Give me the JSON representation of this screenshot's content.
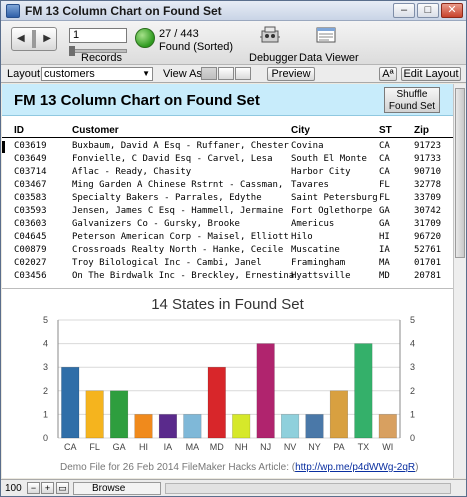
{
  "window": {
    "title": "FM 13 Column Chart on Found Set",
    "minimize_glyph": "–",
    "maximize_glyph": "□",
    "close_glyph": "✕"
  },
  "toolbar": {
    "record_number": "1",
    "records_label": "Records",
    "found_count": "27 / 443",
    "found_status": "Found (Sorted)",
    "debugger_label": "Debugger",
    "data_viewer_label": "Data Viewer",
    "book_icon": "book-navigation-icon",
    "pie_icon": "found-set-pie-icon"
  },
  "layout_bar": {
    "layout_label": "Layout:",
    "layout_value": "customers",
    "view_as_label": "View As:",
    "preview_label": "Preview",
    "font_size_label": "Aª",
    "edit_layout_label": "Edit Layout"
  },
  "header": {
    "title": "FM 13 Column Chart on Found Set",
    "shuffle_label": "Shuffle Found Set"
  },
  "table": {
    "columns": [
      "ID",
      "Customer",
      "City",
      "ST",
      "Zip"
    ],
    "rows": [
      [
        "C03619",
        "Buxbaum, David A Esq - Ruffaner, Chester",
        "Covina",
        "CA",
        "91723"
      ],
      [
        "C03649",
        "Fonvielle, C David Esq - Carvel, Lesa",
        "South El Monte",
        "CA",
        "91733"
      ],
      [
        "C03714",
        "Aflac - Ready, Chasity",
        "Harbor City",
        "CA",
        "90710"
      ],
      [
        "C03467",
        "Ming Garden A Chinese Rstrnt - Cassman,",
        "Tavares",
        "FL",
        "32778"
      ],
      [
        "C03583",
        "Specialty Bakers - Parrales, Edythe",
        "Saint Petersburg",
        "FL",
        "33709"
      ],
      [
        "C03593",
        "Jensen, James C Esq - Hammell, Jermaine",
        "Fort Oglethorpe",
        "GA",
        "30742"
      ],
      [
        "C03603",
        "Galvanizers Co - Gursky, Brooke",
        "Americus",
        "GA",
        "31709"
      ],
      [
        "C04645",
        "Peterson American Corp - Maisel, Elliott",
        "Hilo",
        "HI",
        "96720"
      ],
      [
        "C00879",
        "Crossroads Realty North - Hanke, Cecile",
        "Muscatine",
        "IA",
        "52761"
      ],
      [
        "C02027",
        "Troy Bilological Inc - Cambi, Janel",
        "Framingham",
        "MA",
        "01701"
      ],
      [
        "C03456",
        "On The Birdwalk Inc - Breckley, Ernestina",
        "Hyattsville",
        "MD",
        "20781"
      ]
    ]
  },
  "chart_data": {
    "type": "bar",
    "title": "14 States in Found Set",
    "categories": [
      "CA",
      "FL",
      "GA",
      "HI",
      "IA",
      "MA",
      "MD",
      "NH",
      "NJ",
      "NV",
      "NY",
      "PA",
      "TX",
      "WI"
    ],
    "values": [
      3,
      2,
      2,
      1,
      1,
      1,
      3,
      1,
      4,
      1,
      1,
      2,
      4,
      1
    ],
    "colors": [
      "#2f6ea8",
      "#f5b41e",
      "#2e9e3e",
      "#f08a1c",
      "#5a2a8c",
      "#7fb8d8",
      "#d8262a",
      "#d6e82a",
      "#b0246e",
      "#8fd0dc",
      "#4a78a8",
      "#d8a040",
      "#34b06a",
      "#d8a060"
    ],
    "ylim": [
      0,
      5
    ],
    "yticks": [
      "0",
      "1",
      "2",
      "3",
      "4",
      "5"
    ],
    "grid": true,
    "right_axis": true
  },
  "footnote": {
    "text": "Demo File for 26 Feb 2014 FileMaker Hacks Article: (",
    "link": "http://wp.me/p4dWWg-2qR",
    "close": ")"
  },
  "statusbar": {
    "zoom": "100",
    "mode": "Browse"
  }
}
